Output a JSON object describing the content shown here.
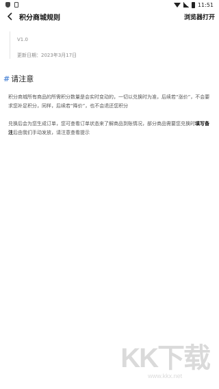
{
  "status_bar": {
    "time": "11:51"
  },
  "header": {
    "title": "积分商城规则",
    "open_browser_label": "浏览器打开"
  },
  "meta": {
    "version": "V1.0",
    "updated": "更新日期：2023年3月17日"
  },
  "section": {
    "hash": "#",
    "title": "请注意"
  },
  "paragraph1": "积分商城所有商品的所需积分数量是会实时变动的，一切以兑换时为准，后续若“涨价”，不会要求您补足积分，同样，后续若“降价”，也不会退还您积分",
  "paragraph2": {
    "text_before": "兑换后会为您生成订单，您可查看订单状态来了解商品到账情况，部分商品需要您兑换时",
    "bold": "填写备注",
    "text_after": "后由我们手动发放，请注意查看提示"
  },
  "watermark": {
    "logo_text": "KK下载",
    "url": "www.kkx.net"
  }
}
